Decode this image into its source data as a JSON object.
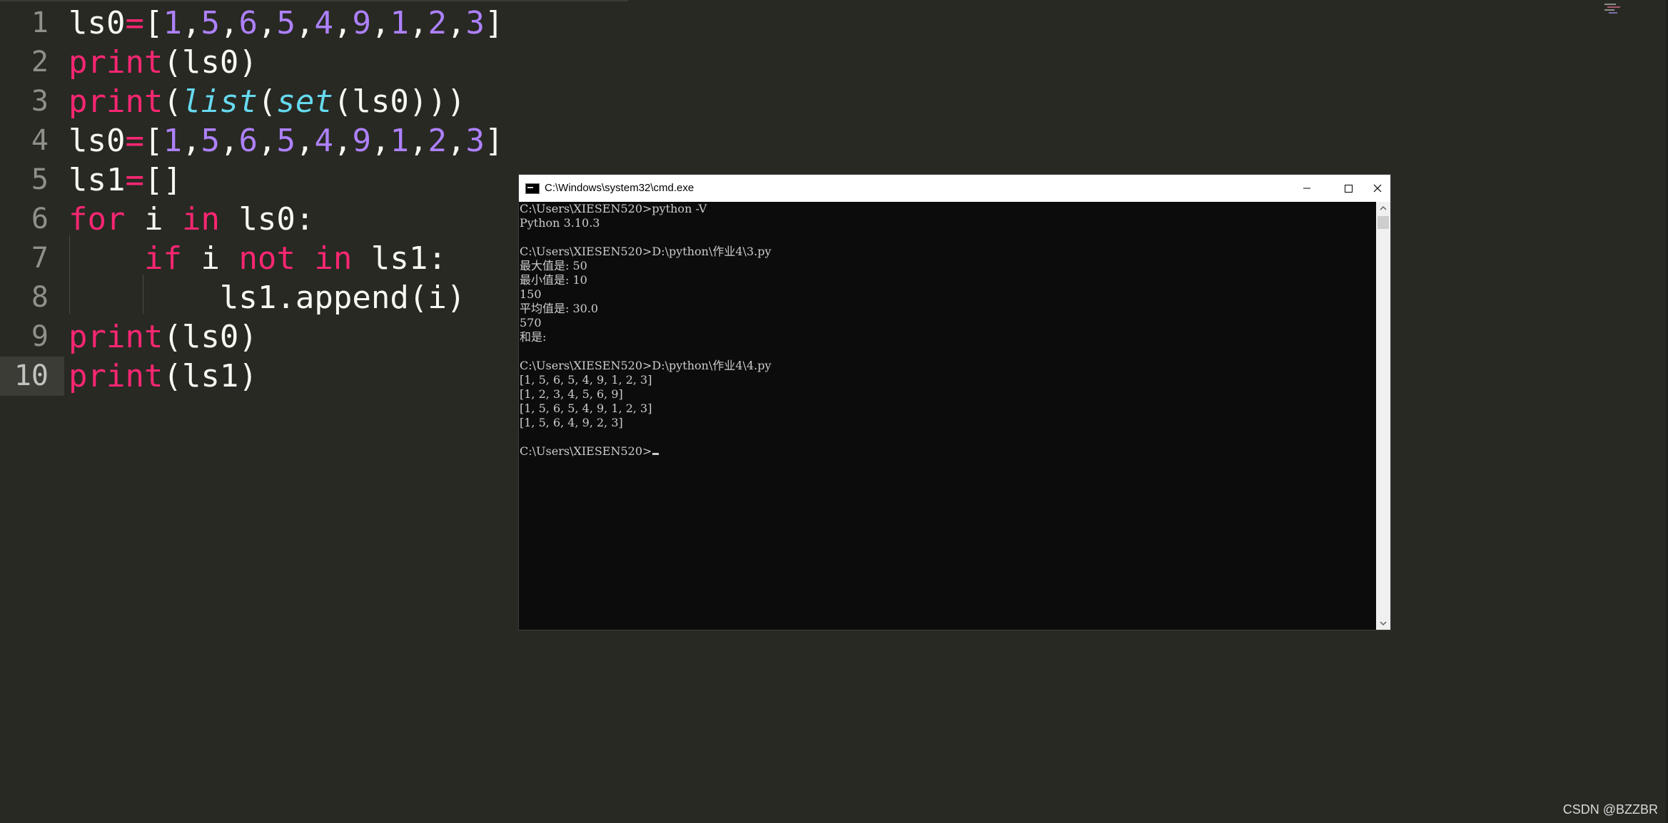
{
  "editor": {
    "current_line": 10,
    "lines": [
      {
        "num": "1",
        "tokens": [
          {
            "t": "ls0",
            "c": "text"
          },
          {
            "t": "=",
            "c": "keyword"
          },
          {
            "t": "[",
            "c": "text"
          },
          {
            "t": "1",
            "c": "number"
          },
          {
            "t": ",",
            "c": "text"
          },
          {
            "t": "5",
            "c": "number"
          },
          {
            "t": ",",
            "c": "text"
          },
          {
            "t": "6",
            "c": "number"
          },
          {
            "t": ",",
            "c": "text"
          },
          {
            "t": "5",
            "c": "number"
          },
          {
            "t": ",",
            "c": "text"
          },
          {
            "t": "4",
            "c": "number"
          },
          {
            "t": ",",
            "c": "text"
          },
          {
            "t": "9",
            "c": "number"
          },
          {
            "t": ",",
            "c": "text"
          },
          {
            "t": "1",
            "c": "number"
          },
          {
            "t": ",",
            "c": "text"
          },
          {
            "t": "2",
            "c": "number"
          },
          {
            "t": ",",
            "c": "text"
          },
          {
            "t": "3",
            "c": "number"
          },
          {
            "t": "]",
            "c": "text"
          }
        ]
      },
      {
        "num": "2",
        "tokens": [
          {
            "t": "print",
            "c": "keyword"
          },
          {
            "t": "(ls0)",
            "c": "text"
          }
        ]
      },
      {
        "num": "3",
        "tokens": [
          {
            "t": "print",
            "c": "keyword"
          },
          {
            "t": "(",
            "c": "text"
          },
          {
            "t": "list",
            "c": "builtin"
          },
          {
            "t": "(",
            "c": "text"
          },
          {
            "t": "set",
            "c": "builtin"
          },
          {
            "t": "(ls0)))",
            "c": "text"
          }
        ]
      },
      {
        "num": "4",
        "tokens": [
          {
            "t": "ls0",
            "c": "text"
          },
          {
            "t": "=",
            "c": "keyword"
          },
          {
            "t": "[",
            "c": "text"
          },
          {
            "t": "1",
            "c": "number"
          },
          {
            "t": ",",
            "c": "text"
          },
          {
            "t": "5",
            "c": "number"
          },
          {
            "t": ",",
            "c": "text"
          },
          {
            "t": "6",
            "c": "number"
          },
          {
            "t": ",",
            "c": "text"
          },
          {
            "t": "5",
            "c": "number"
          },
          {
            "t": ",",
            "c": "text"
          },
          {
            "t": "4",
            "c": "number"
          },
          {
            "t": ",",
            "c": "text"
          },
          {
            "t": "9",
            "c": "number"
          },
          {
            "t": ",",
            "c": "text"
          },
          {
            "t": "1",
            "c": "number"
          },
          {
            "t": ",",
            "c": "text"
          },
          {
            "t": "2",
            "c": "number"
          },
          {
            "t": ",",
            "c": "text"
          },
          {
            "t": "3",
            "c": "number"
          },
          {
            "t": "]",
            "c": "text"
          }
        ]
      },
      {
        "num": "5",
        "tokens": [
          {
            "t": "ls1",
            "c": "text"
          },
          {
            "t": "=",
            "c": "keyword"
          },
          {
            "t": "[]",
            "c": "text"
          }
        ]
      },
      {
        "num": "6",
        "tokens": [
          {
            "t": "for",
            "c": "keyword"
          },
          {
            "t": " i ",
            "c": "text"
          },
          {
            "t": "in",
            "c": "keyword"
          },
          {
            "t": " ls0:",
            "c": "text"
          }
        ]
      },
      {
        "num": "7",
        "tokens": [
          {
            "t": "    ",
            "c": "text"
          },
          {
            "t": "if",
            "c": "keyword"
          },
          {
            "t": " i ",
            "c": "text"
          },
          {
            "t": "not",
            "c": "keyword"
          },
          {
            "t": " ",
            "c": "text"
          },
          {
            "t": "in",
            "c": "keyword"
          },
          {
            "t": " ls1:",
            "c": "text"
          }
        ]
      },
      {
        "num": "8",
        "tokens": [
          {
            "t": "        ls1.append(i)",
            "c": "text"
          }
        ]
      },
      {
        "num": "9",
        "tokens": [
          {
            "t": "print",
            "c": "keyword"
          },
          {
            "t": "(ls0)",
            "c": "text"
          }
        ]
      },
      {
        "num": "10",
        "tokens": [
          {
            "t": "print",
            "c": "keyword"
          },
          {
            "t": "(ls1)",
            "c": "text"
          }
        ]
      }
    ]
  },
  "cmd": {
    "title": "C:\\Windows\\system32\\cmd.exe",
    "lines": [
      "C:\\Users\\XIESEN520>python -V",
      "Python 3.10.3",
      "",
      "C:\\Users\\XIESEN520>D:\\python\\作业4\\3.py",
      "最大值是: 50",
      "最小值是: 10",
      "150",
      "平均值是: 30.0",
      "570",
      "和是:",
      "",
      "C:\\Users\\XIESEN520>D:\\python\\作业4\\4.py",
      "[1, 5, 6, 5, 4, 9, 1, 2, 3]",
      "[1, 2, 3, 4, 5, 6, 9]",
      "[1, 5, 6, 5, 4, 9, 1, 2, 3]",
      "[1, 5, 6, 4, 9, 2, 3]",
      "",
      "C:\\Users\\XIESEN520>"
    ]
  },
  "watermark": "CSDN @BZZBR",
  "colors": {
    "editor_bg": "#282923",
    "number": "#ae81ff",
    "keyword": "#f92672",
    "builtin": "#66d9ef",
    "text": "#f8f8f2",
    "terminal_bg": "#0c0c0c",
    "terminal_fg": "#cccccc"
  },
  "icons": {
    "cmd_app": "cmd-app-icon",
    "minimize": "minimize-icon",
    "maximize": "maximize-icon",
    "close": "close-icon",
    "scroll_up": "chevron-up-icon",
    "scroll_down": "chevron-down-icon",
    "minimap": "minimap-icon"
  }
}
